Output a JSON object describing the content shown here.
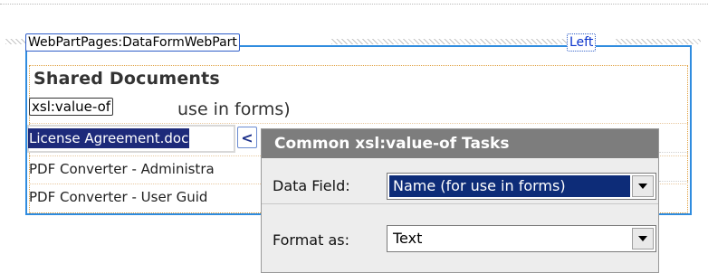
{
  "webpart": {
    "type_tag": "WebPartPages:DataFormWebPart",
    "zone_tag": "Left",
    "title": "Shared Documents"
  },
  "xsl_tag": "xsl:value-of",
  "column_header_partial": "use in forms)",
  "rows": [
    "License Agreement.doc",
    "PDF Converter - Administra",
    "PDF Converter - User Guid"
  ],
  "chevron": "<",
  "tasks_panel": {
    "title": "Common xsl:value-of Tasks",
    "data_field_label": "Data Field:",
    "data_field_value": "Name (for use in forms)",
    "format_as_label": "Format as:",
    "format_as_value": "Text"
  },
  "icons": {
    "dropdown": "chevron-down-icon",
    "collapse": "chevron-left-icon"
  },
  "colors": {
    "webpart_border": "#2f8cdf",
    "selection": "#1d2a7a",
    "panel_header": "#7d7d7d",
    "panel_bg": "#ededed"
  }
}
